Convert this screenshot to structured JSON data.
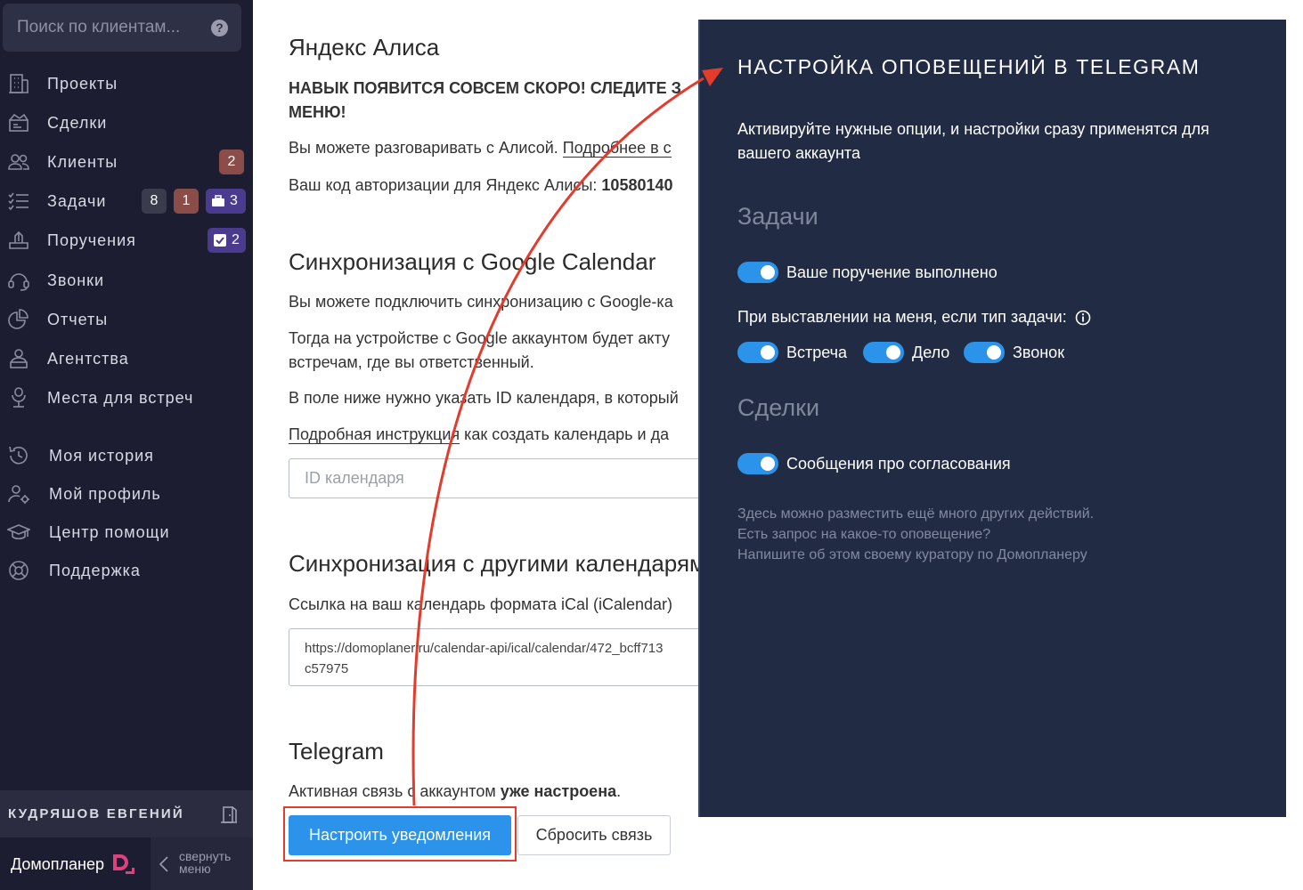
{
  "sidebar": {
    "search_placeholder": "Поиск по клиентам...",
    "help_glyph": "?",
    "nav": [
      {
        "label": "Проекты",
        "icon": "building-icon"
      },
      {
        "label": "Сделки",
        "icon": "handshake-icon"
      },
      {
        "label": "Клиенты",
        "icon": "users-icon",
        "badges": [
          "2"
        ]
      },
      {
        "label": "Задачи",
        "icon": "task-list-icon",
        "badges": [
          "8",
          "1",
          "3"
        ]
      },
      {
        "label": "Поручения",
        "icon": "assignment-icon",
        "badges": [
          "2"
        ]
      },
      {
        "label": "Звонки",
        "icon": "headset-icon"
      },
      {
        "label": "Отчеты",
        "icon": "pie-chart-icon"
      },
      {
        "label": "Агентства",
        "icon": "agency-icon"
      },
      {
        "label": "Места для встреч",
        "icon": "meeting-place-icon"
      }
    ],
    "nav_lower": [
      {
        "label": "Моя история",
        "icon": "history-icon"
      },
      {
        "label": "Мой профиль",
        "icon": "profile-settings-icon"
      },
      {
        "label": "Центр помощи",
        "icon": "graduation-cap-icon"
      },
      {
        "label": "Поддержка",
        "icon": "lifebuoy-icon"
      }
    ],
    "user_name": "КУДРЯШОВ ЕВГЕНИЙ",
    "brand": "Домопланер",
    "collapse_label_1": "свернуть",
    "collapse_label_2": "меню"
  },
  "main": {
    "alice": {
      "title": "Яндекс Алиса",
      "notice_1": "НАВЫК ПОЯВИТСЯ СОВСЕМ СКОРО! СЛЕДИТЕ З",
      "notice_2": "МЕНЮ!",
      "talk_text": "Вы можете разговаривать с Алисой. ",
      "talk_link": "Подробнее в с",
      "auth_text": "Ваш код авторизации для Яндекс Алисы: ",
      "auth_code": "10580140"
    },
    "gcal": {
      "title": "Синхронизация с Google Calendar",
      "line1": "Вы можете подключить синхронизацию с Google-ка",
      "line2": "Тогда на устройстве с Google аккаунтом будет акту",
      "line3": "встречам, где вы ответственный.",
      "line4": "В поле ниже нужно указать ID календаря, в который",
      "instr_link": "Подробная инструкция",
      "instr_rest": " как создать календарь и да",
      "id_placeholder": "ID календаря"
    },
    "other_cal": {
      "title": "Синхронизация с другими календарями",
      "label": "Ссылка на ваш календарь формата iCal (iCalendar)",
      "url_line1": "https://domoplaner.ru/calendar-api/ical/calendar/472_bcff713",
      "url_line2": "c57975"
    },
    "telegram": {
      "title": "Telegram",
      "status_text": "Активная связь с аккаунтом ",
      "status_bold": "уже настроена",
      "status_end": ".",
      "configure_button": "Настроить уведомления",
      "reset_button": "Сбросить связь"
    }
  },
  "panel": {
    "title": "НАСТРОЙКА ОПОВЕЩЕНИЙ В TELEGRAM",
    "description": "Активируйте нужные опции, и настройки сразу применятся для вашего аккаунта",
    "tasks_heading": "Задачи",
    "opt_assignment_done": "Ваше поручение выполнено",
    "assign_prompt": "При выставлении на меня, если тип задачи:",
    "opt_meeting": "Встреча",
    "opt_case": "Дело",
    "opt_call": "Звонок",
    "deals_heading": "Сделки",
    "opt_approvals": "Сообщения про согласования",
    "note_1": "Здесь можно разместить ещё много других действий.",
    "note_2": "Есть запрос на какое-то оповещение?",
    "note_3": "Напишите об этом своему куратору по Домопланеру"
  },
  "colors": {
    "sidebar_bg": "#1c1d31",
    "panel_bg": "#222b44",
    "accent_blue": "#2b93ea",
    "badge_red": "#8b4d4a",
    "badge_purple": "#4b3b8e",
    "annotation_red": "#e33b2c"
  }
}
